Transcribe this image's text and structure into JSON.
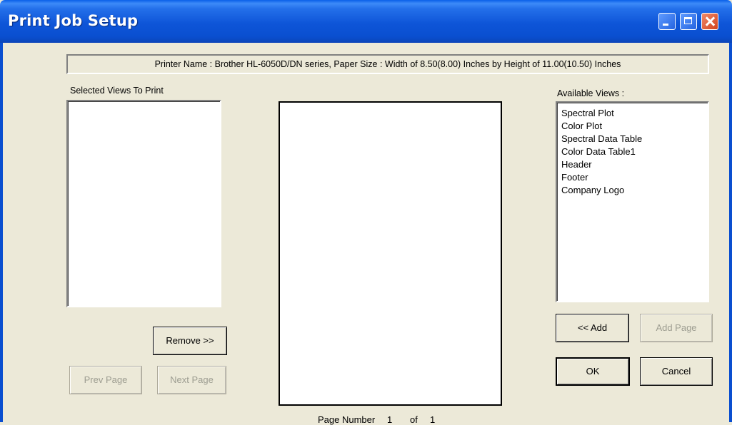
{
  "window": {
    "title": "Print Job Setup"
  },
  "printer_info": "Printer Name : Brother HL-6050D/DN series, Paper Size : Width of 8.50(8.00) Inches by Height of 11.00(10.50) Inches",
  "selected_views": {
    "label": "Selected Views To Print",
    "items": []
  },
  "available_views": {
    "label": "Available Views :",
    "items": [
      "Spectral Plot",
      "Color Plot",
      "Spectral Data Table",
      "Color Data Table1",
      "Header",
      "Footer",
      "Company Logo"
    ]
  },
  "buttons": {
    "remove": "Remove >>",
    "add": "<< Add",
    "add_page": "Add Page",
    "prev_page": "Prev Page",
    "next_page": "Next Page",
    "ok": "OK",
    "cancel": "Cancel"
  },
  "page_number": {
    "label": "Page Number",
    "current": "1",
    "of_label": "of",
    "total": "1"
  }
}
